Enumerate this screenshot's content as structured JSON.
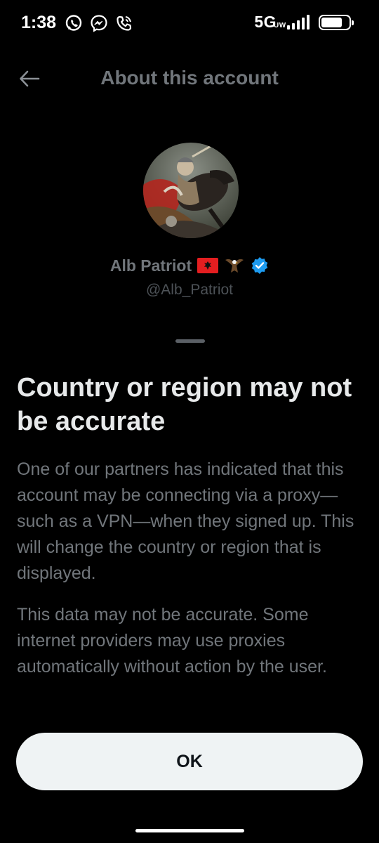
{
  "status_bar": {
    "time": "1:38",
    "network": "5G",
    "network_suffix": "UW",
    "left_icons": [
      "whatsapp-icon",
      "messenger-icon",
      "phone-call-icon"
    ],
    "battery_level": 0.75
  },
  "header": {
    "title": "About this account",
    "back_icon": "arrow-left-icon"
  },
  "profile": {
    "display_name": "Alb Patriot",
    "handle": "@Alb_Patriot",
    "badges": [
      "albania-flag-emoji",
      "eagle-emoji",
      "verified-badge-icon"
    ]
  },
  "sheet": {
    "heading": "Country or region may not be accurate",
    "paragraph_1": "One of our partners has indicated that this account may be connecting via a proxy—such as a VPN—when they signed up. This will change the country or region that is displayed.",
    "paragraph_2": "This data may not be accurate. Some internet providers may use proxies automatically without action by the user.",
    "ok_label": "OK"
  },
  "colors": {
    "background": "#000000",
    "muted_text": "#71767b",
    "heading_text": "#e7e9ea",
    "verified_blue": "#1d9bf0",
    "button_bg": "#eff3f4",
    "flag_red": "#e41e20"
  }
}
